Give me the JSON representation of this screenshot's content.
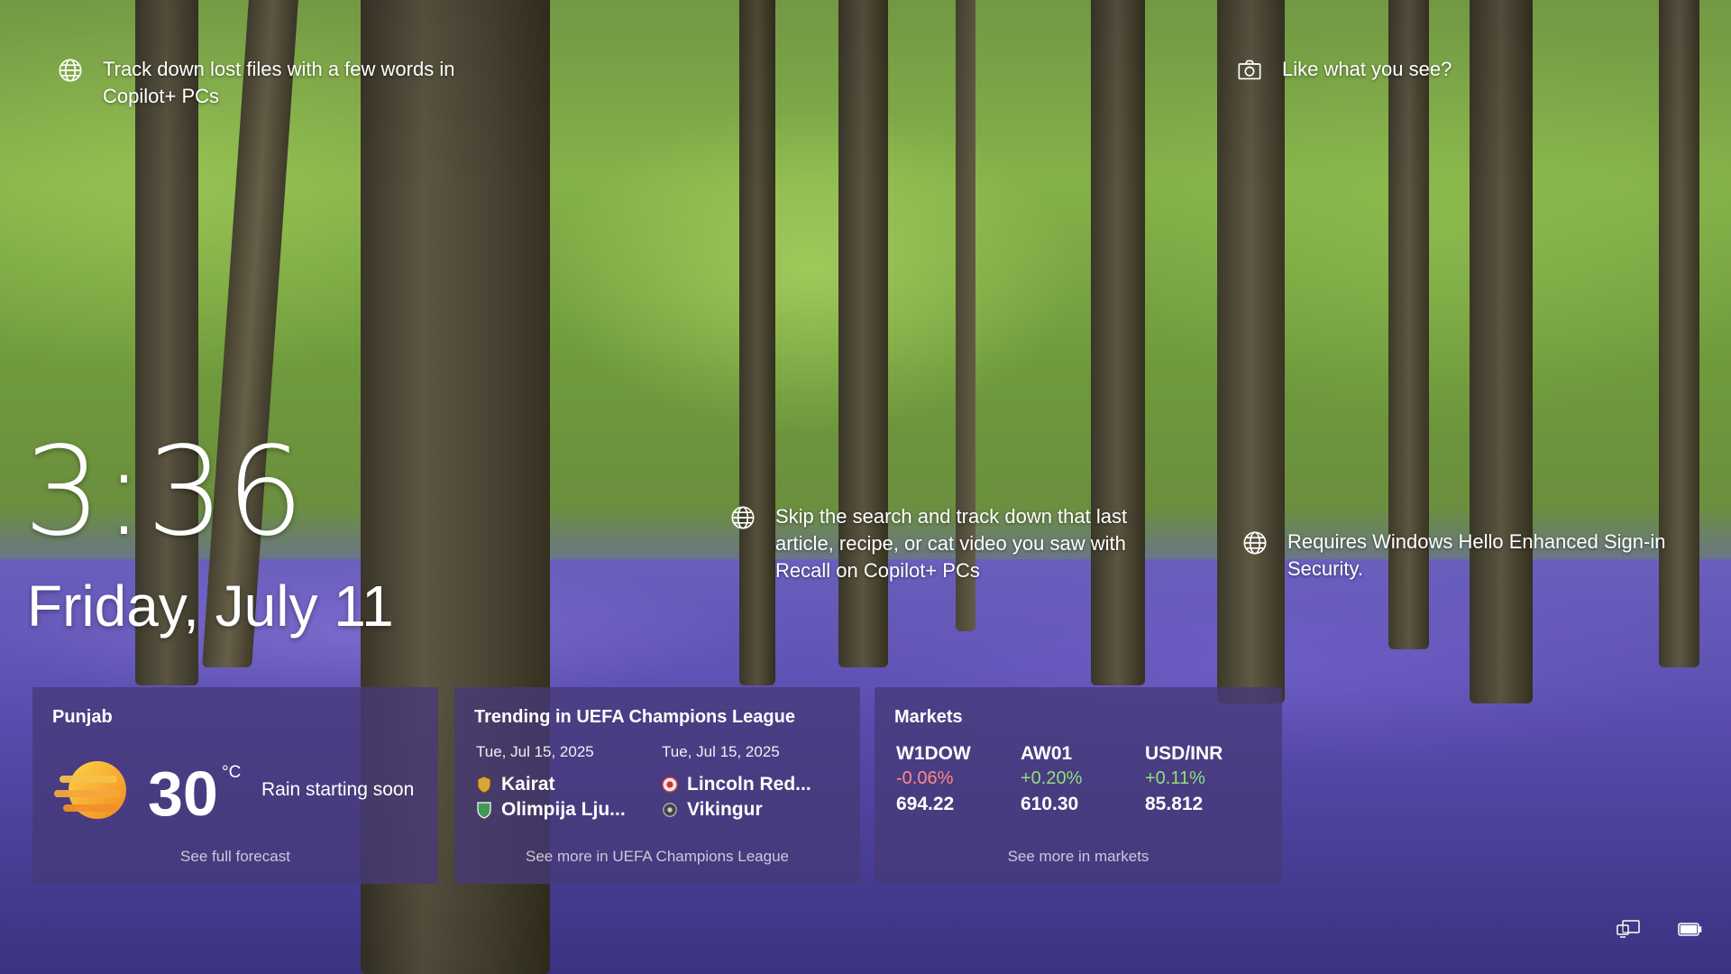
{
  "tips": {
    "left": "Track down lost files with a few words in Copilot+ PCs",
    "middle": "Skip the search and track down that last article, recipe, or cat video you saw with Recall on Copilot+ PCs",
    "right_top": "Like what you see?",
    "right_middle": "Requires Windows Hello Enhanced Sign-in Security."
  },
  "clock": {
    "time": "3:36",
    "date": "Friday, July 11"
  },
  "weather": {
    "location": "Punjab",
    "temperature": "30",
    "unit": "°C",
    "condition": "Rain starting soon",
    "footer": "See full forecast",
    "icon": "sun-haze-icon"
  },
  "sports": {
    "title": "Trending in UEFA Champions League",
    "matches": [
      {
        "date": "Tue, Jul 15, 2025",
        "team1": "Kairat",
        "team2": "Olimpija Lju..."
      },
      {
        "date": "Tue, Jul 15, 2025",
        "team1": "Lincoln Red...",
        "team2": "Vikingur"
      }
    ],
    "footer": "See more in UEFA Champions League"
  },
  "markets": {
    "title": "Markets",
    "stocks": [
      {
        "symbol": "W1DOW",
        "change": "-0.06%",
        "price": "694.22",
        "direction": "down"
      },
      {
        "symbol": "AW01",
        "change": "+0.20%",
        "price": "610.30",
        "direction": "up"
      },
      {
        "symbol": "USD/INR",
        "change": "+0.11%",
        "price": "85.812",
        "direction": "up"
      }
    ],
    "footer": "See more in markets"
  },
  "colors": {
    "negative": "#ff8a8a",
    "positive": "#8fe07a",
    "card_bg": "#463a78"
  }
}
